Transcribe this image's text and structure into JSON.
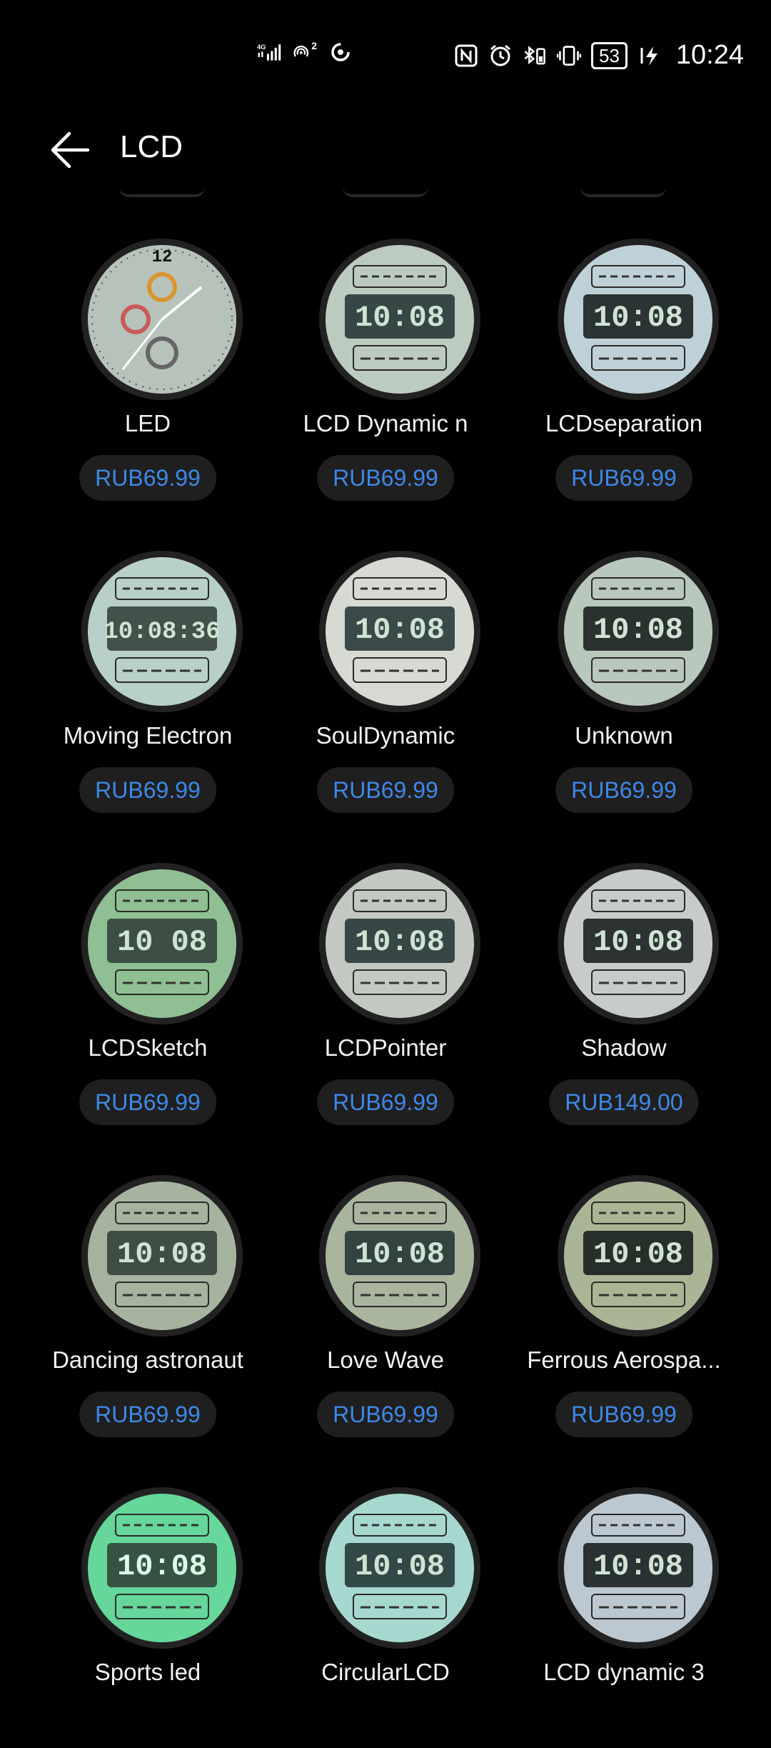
{
  "status_bar": {
    "network": "4G",
    "hotspot_count": "2",
    "battery": "53",
    "time": "10:24"
  },
  "header": {
    "title": "LCD"
  },
  "faces": [
    {
      "name": "LED",
      "price": "RUB69.99",
      "face_color": "#b7c3ba"
    },
    {
      "name": "LCD Dynamic n",
      "price": "RUB69.99",
      "face_color": "#bccbc0"
    },
    {
      "name": "LCDseparation",
      "price": "RUB69.99",
      "face_color": "#bfd1d8"
    },
    {
      "name": "Moving Electron",
      "price": "RUB69.99",
      "face_color": "#b8cfca"
    },
    {
      "name": "SoulDynamic",
      "price": "RUB69.99",
      "face_color": "#d7d9d3"
    },
    {
      "name": "Unknown",
      "price": "RUB69.99",
      "face_color": "#b9c8bd"
    },
    {
      "name": "LCDSketch",
      "price": "RUB69.99",
      "face_color": "#8fbf93"
    },
    {
      "name": "LCDPointer",
      "price": "RUB69.99",
      "face_color": "#c3c9c2"
    },
    {
      "name": "Shadow",
      "price": "RUB149.00",
      "face_color": "#c7ccc8"
    },
    {
      "name": "Dancing astronaut",
      "price": "RUB69.99",
      "face_color": "#a6b39f"
    },
    {
      "name": "Love Wave",
      "price": "RUB69.99",
      "face_color": "#a9b59d"
    },
    {
      "name": "Ferrous Aerospa...",
      "price": "RUB69.99",
      "face_color": "#aab596"
    },
    {
      "name": "Sports led",
      "price": "",
      "face_color": "#66d69a"
    },
    {
      "name": "CircularLCD",
      "price": "",
      "face_color": "#a7d8d0"
    },
    {
      "name": "LCD dynamic 3",
      "price": "",
      "face_color": "#bcc8d1"
    }
  ],
  "face_texts": [
    "12",
    "10:08",
    "10:08",
    "10:08:36",
    "10:08",
    "10:08",
    "10\n08",
    "10:08",
    "10:08",
    "10:08",
    "10:08",
    "10:08",
    "10:08",
    "10:08",
    "10:08"
  ]
}
